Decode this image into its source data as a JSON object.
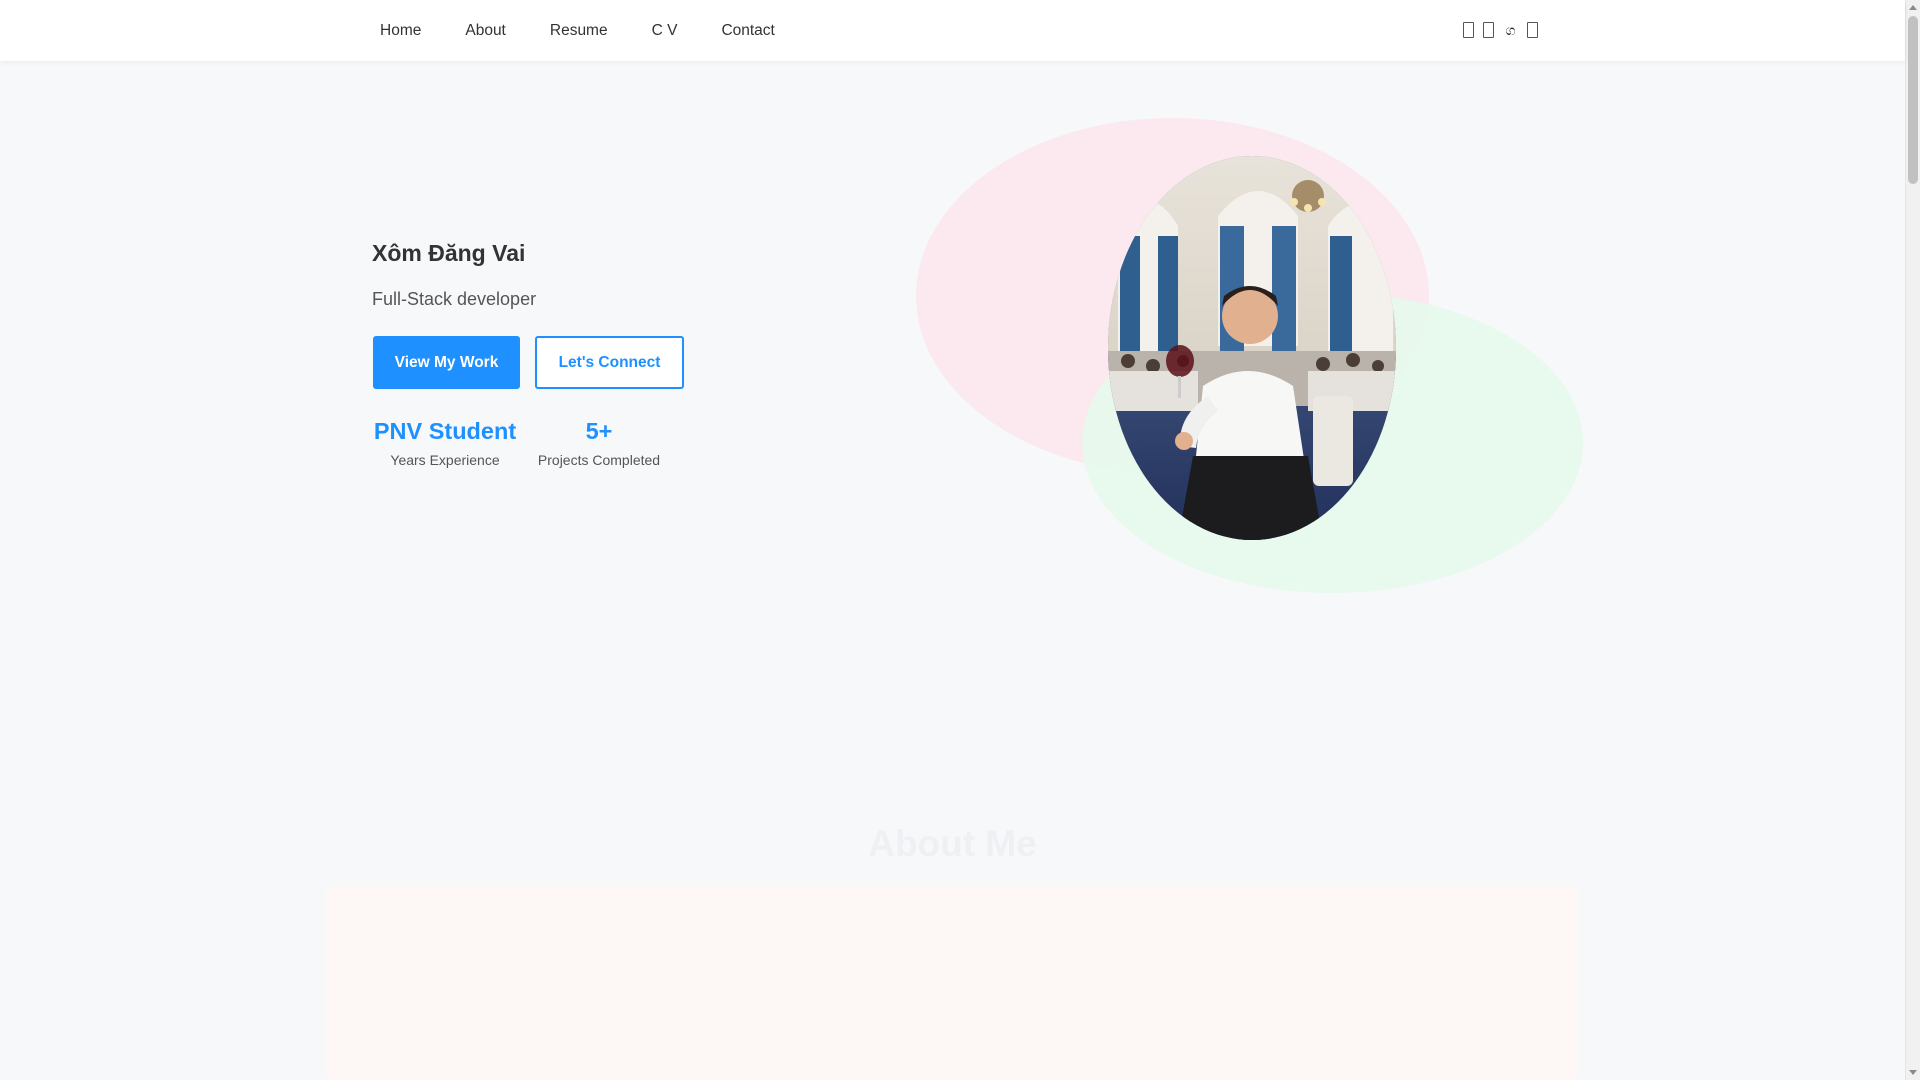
{
  "nav": {
    "links": [
      "Home",
      "About",
      "Resume",
      "C V",
      "Contact"
    ]
  },
  "social": {
    "icons": [
      "facebook-icon",
      "linkedin-icon",
      "messenger-icon",
      "github-icon"
    ],
    "glyph_3": "ග"
  },
  "hero": {
    "name": "Xôm Đăng Vai",
    "role": "Full-Stack developer",
    "primary_button": "View My Work",
    "secondary_button": "Let's Connect",
    "stats": [
      {
        "value": "PNV Student",
        "label": "Years Experience"
      },
      {
        "value": "5+",
        "label": "Projects Completed"
      }
    ]
  },
  "about": {
    "title": "About Me"
  },
  "colors": {
    "accent": "#1e90ff",
    "blob_pink": "#fbe9ef",
    "blob_green": "#e6f8ec",
    "background": "#f7f8fa"
  }
}
